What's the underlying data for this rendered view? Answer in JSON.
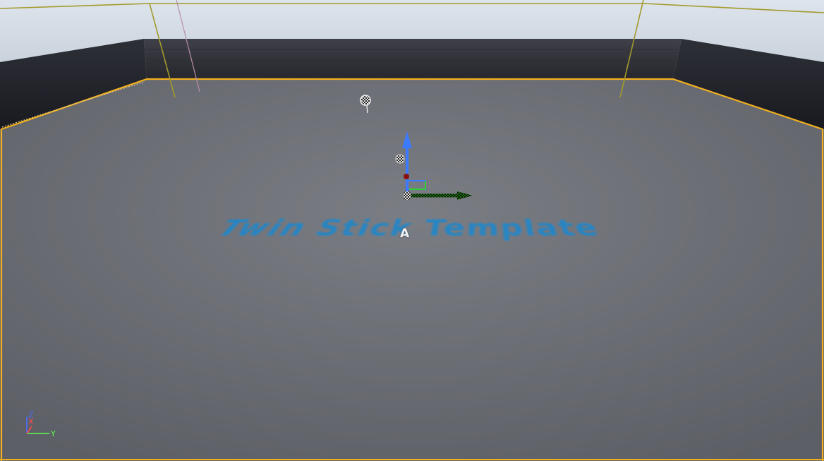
{
  "viewport": {
    "floor_text": "Twin Stick Template",
    "actor_label": "A"
  },
  "axis_indicator": {
    "z_label": "Z",
    "x_label": "X",
    "y_label": "Y"
  },
  "colors": {
    "sky": "#dfe6ee",
    "floor": "#6f7178",
    "wall": "#2a2c33",
    "selection_outline": "#f2b01e",
    "floor_text": "#1f86c9",
    "gizmo_z": "#3c7bff",
    "gizmo_y": "#2fd13b"
  },
  "icons": [
    "light-source-icon",
    "transform-gizmo",
    "axis-indicator-icon"
  ]
}
